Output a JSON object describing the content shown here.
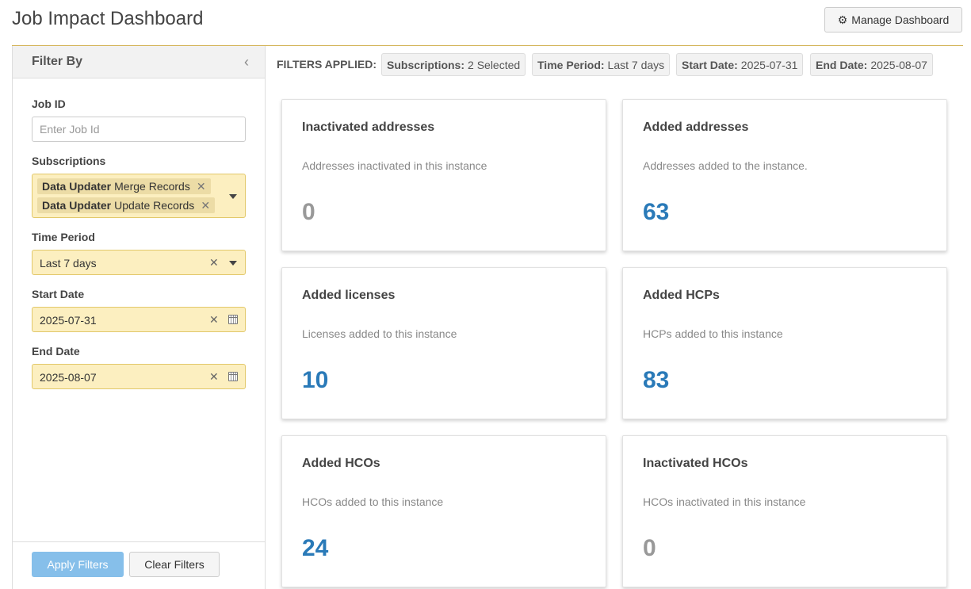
{
  "header": {
    "title": "Job Impact Dashboard",
    "manage_label": "Manage Dashboard"
  },
  "sidebar": {
    "title": "Filter By",
    "job_id": {
      "label": "Job ID",
      "placeholder": "Enter Job Id",
      "value": ""
    },
    "subscriptions": {
      "label": "Subscriptions",
      "tags": [
        {
          "bold": "Data Updater",
          "text": "Merge Records"
        },
        {
          "bold": "Data Updater",
          "text": "Update Records"
        }
      ]
    },
    "time_period": {
      "label": "Time Period",
      "value": "Last 7 days"
    },
    "start_date": {
      "label": "Start Date",
      "value": "2025-07-31"
    },
    "end_date": {
      "label": "End Date",
      "value": "2025-08-07"
    },
    "apply_label": "Apply Filters",
    "clear_label": "Clear Filters"
  },
  "filters_applied": {
    "label": "FILTERS APPLIED:",
    "chips": [
      {
        "key": "Subscriptions:",
        "value": "2 Selected"
      },
      {
        "key": "Time Period:",
        "value": "Last 7 days"
      },
      {
        "key": "Start Date:",
        "value": "2025-07-31"
      },
      {
        "key": "End Date:",
        "value": "2025-08-07"
      }
    ]
  },
  "cards": [
    {
      "title": "Inactivated addresses",
      "description": "Addresses inactivated in this instance",
      "value": "0",
      "color": "#999999"
    },
    {
      "title": "Added addresses",
      "description": "Addresses added to the instance.",
      "value": "63",
      "color": "#2a7ab8"
    },
    {
      "title": "Added licenses",
      "description": "Licenses added to this instance",
      "value": "10",
      "color": "#2a7ab8"
    },
    {
      "title": "Added HCPs",
      "description": "HCPs added to this instance",
      "value": "83",
      "color": "#2a7ab8"
    },
    {
      "title": "Added HCOs",
      "description": "HCOs added to this instance",
      "value": "24",
      "color": "#2a7ab8"
    },
    {
      "title": "Inactivated HCOs",
      "description": "HCOs inactivated in this instance",
      "value": "0",
      "color": "#999999"
    }
  ],
  "colors": {
    "accent_rule": "#d4b55a",
    "filled_field": "#fcefc0",
    "apply_button": "#86bfea",
    "value_blue": "#2a7ab8",
    "value_gray": "#999999"
  },
  "icons": {
    "manage": "gear-icon",
    "collapse": "chevron-left-icon",
    "clear": "close-icon",
    "dropdown": "caret-down-icon",
    "date": "calendar-icon"
  }
}
